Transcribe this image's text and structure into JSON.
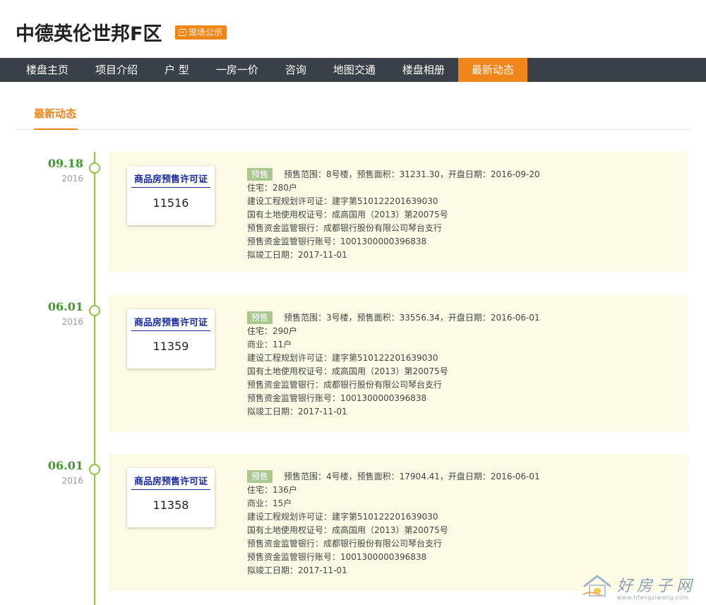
{
  "header": {
    "title": "中德英伦世邦F区",
    "badge": "现场公示"
  },
  "nav": {
    "items": [
      {
        "label": "楼盘主页"
      },
      {
        "label": "项目介绍"
      },
      {
        "label": "户 型"
      },
      {
        "label": "一房一价"
      },
      {
        "label": "咨询"
      },
      {
        "label": "地图交通"
      },
      {
        "label": "楼盘相册"
      },
      {
        "label": "最新动态"
      }
    ],
    "active": "最新动态"
  },
  "section": {
    "tab": "最新动态"
  },
  "entries": [
    {
      "date": "09.18",
      "year": "2016",
      "license_title": "商品房预售许可证",
      "license_no": "11516",
      "tag": "预售",
      "summary": "预售范围：8号楼，预售面积：31231.30，开盘日期：2016-09-20",
      "lines": [
        "住宅：280户",
        "建设工程规划许可证：建字第510122201639030",
        "国有土地使用权证号：成高国用（2013）第20075号",
        "预售资金监管银行：成都银行股份有限公司琴台支行",
        "预售资金监管银行账号：1001300000396838",
        "拟竣工日期：2017-11-01"
      ]
    },
    {
      "date": "06.01",
      "year": "2016",
      "license_title": "商品房预售许可证",
      "license_no": "11359",
      "tag": "预售",
      "summary": "预售范围：3号楼，预售面积：33556.34，开盘日期：2016-06-01",
      "lines": [
        "住宅：290户",
        "商业：11户",
        "建设工程规划许可证：建字第510122201639030",
        "国有土地使用权证号：成高国用（2013）第20075号",
        "预售资金监管银行：成都银行股份有限公司琴台支行",
        "预售资金监管银行账号：1001300000396838",
        "拟竣工日期：2017-11-01"
      ]
    },
    {
      "date": "06.01",
      "year": "2016",
      "license_title": "商品房预售许可证",
      "license_no": "11358",
      "tag": "预售",
      "summary": "预售范围：4号楼，预售面积：17904.41，开盘日期：2016-06-01",
      "lines": [
        "住宅：136户",
        "商业：15户",
        "建设工程规划许可证：建字第510122201639030",
        "国有土地使用权证号：成高国用（2013）第20075号",
        "预售资金监管银行：成都银行股份有限公司琴台支行",
        "预售资金监管银行账号：1001300000396838",
        "拟竣工日期：2017-11-01"
      ]
    }
  ],
  "watermark": {
    "text": "好房子网",
    "url": "www.hfangziwang.com"
  },
  "colors": {
    "accent": "#f08519",
    "nav_bg": "#3a4047",
    "timeline": "#8cc63f",
    "date": "#3d9a2e",
    "card_bg": "#fdfbe5",
    "license_title": "#1a2aa0",
    "tag_bg": "#a8c88e"
  }
}
